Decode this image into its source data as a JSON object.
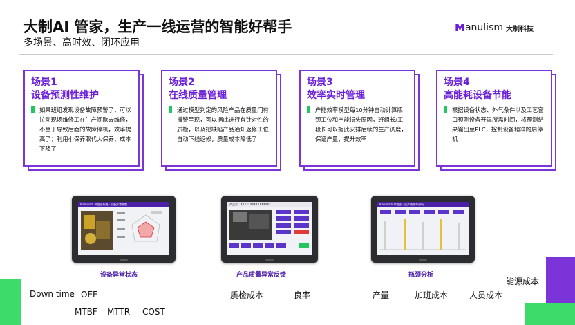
{
  "header": {
    "title": "大制AI 管家，生产一线运营的智能好帮手",
    "subtitle": "多场景、高时效、闭环应用"
  },
  "logo": {
    "mark": "M",
    "name": "anulism",
    "cn": "大制科技"
  },
  "colors": {
    "accent": "#6a1fd8",
    "bullet": "#22c55e",
    "deco_green": "#3ddc6a"
  },
  "scenarios": [
    {
      "title1": "场景1",
      "title2": "设备预测性维护",
      "body": "如果班组发现设备故障预警了，可以拉动现场维修工在生产间歇去维修，不至于导致后面的故障停机，效率提高了；利用小保养取代大保养，成本下降了"
    },
    {
      "title1": "场景2",
      "title2": "在线质量管理",
      "body": "通过模型判定的风险产品在质量门有报警呈现，可以据此进行有针对性的质检，以及把缺陷产品通知返修工位自动下线返修，质量成本降低了"
    },
    {
      "title1": "场景3",
      "title2": "效率实时管理",
      "body": "产能效率模型每10分钟自动计算瓶颈工位和产能损失原因，班组长/工段长可以据此安排后续的生产调度，保证产量，提升效率"
    },
    {
      "title1": "场景4",
      "title2": "高能耗设备节能",
      "body": "根据设备状态、外气条件以及工艺窗口预测设备开温所需时间，将预测结果输出至PLC，控制设备精准的启停机"
    }
  ],
  "screens": [
    {
      "caption": "设备异常状态",
      "bar": "Manulism AI管家系统 · 设备异常预警"
    },
    {
      "caption": "产品质量异常反馈",
      "bar": "产品号：XXXXXXXXXXXXXXXX"
    },
    {
      "caption": "瓶颈分析",
      "bar": "Manulism AI管家 · 生产线效率分析"
    }
  ],
  "metrics": {
    "downtime": "Down time",
    "oee": "OEE",
    "mtbf": "MTBF",
    "mttr": "MTTR",
    "cost": "COST",
    "quality_cost": "质检成本",
    "yield": "良率",
    "output": "产量",
    "overtime_cost": "加班成本",
    "labor_cost": "人员成本",
    "energy_cost": "能源成本"
  }
}
